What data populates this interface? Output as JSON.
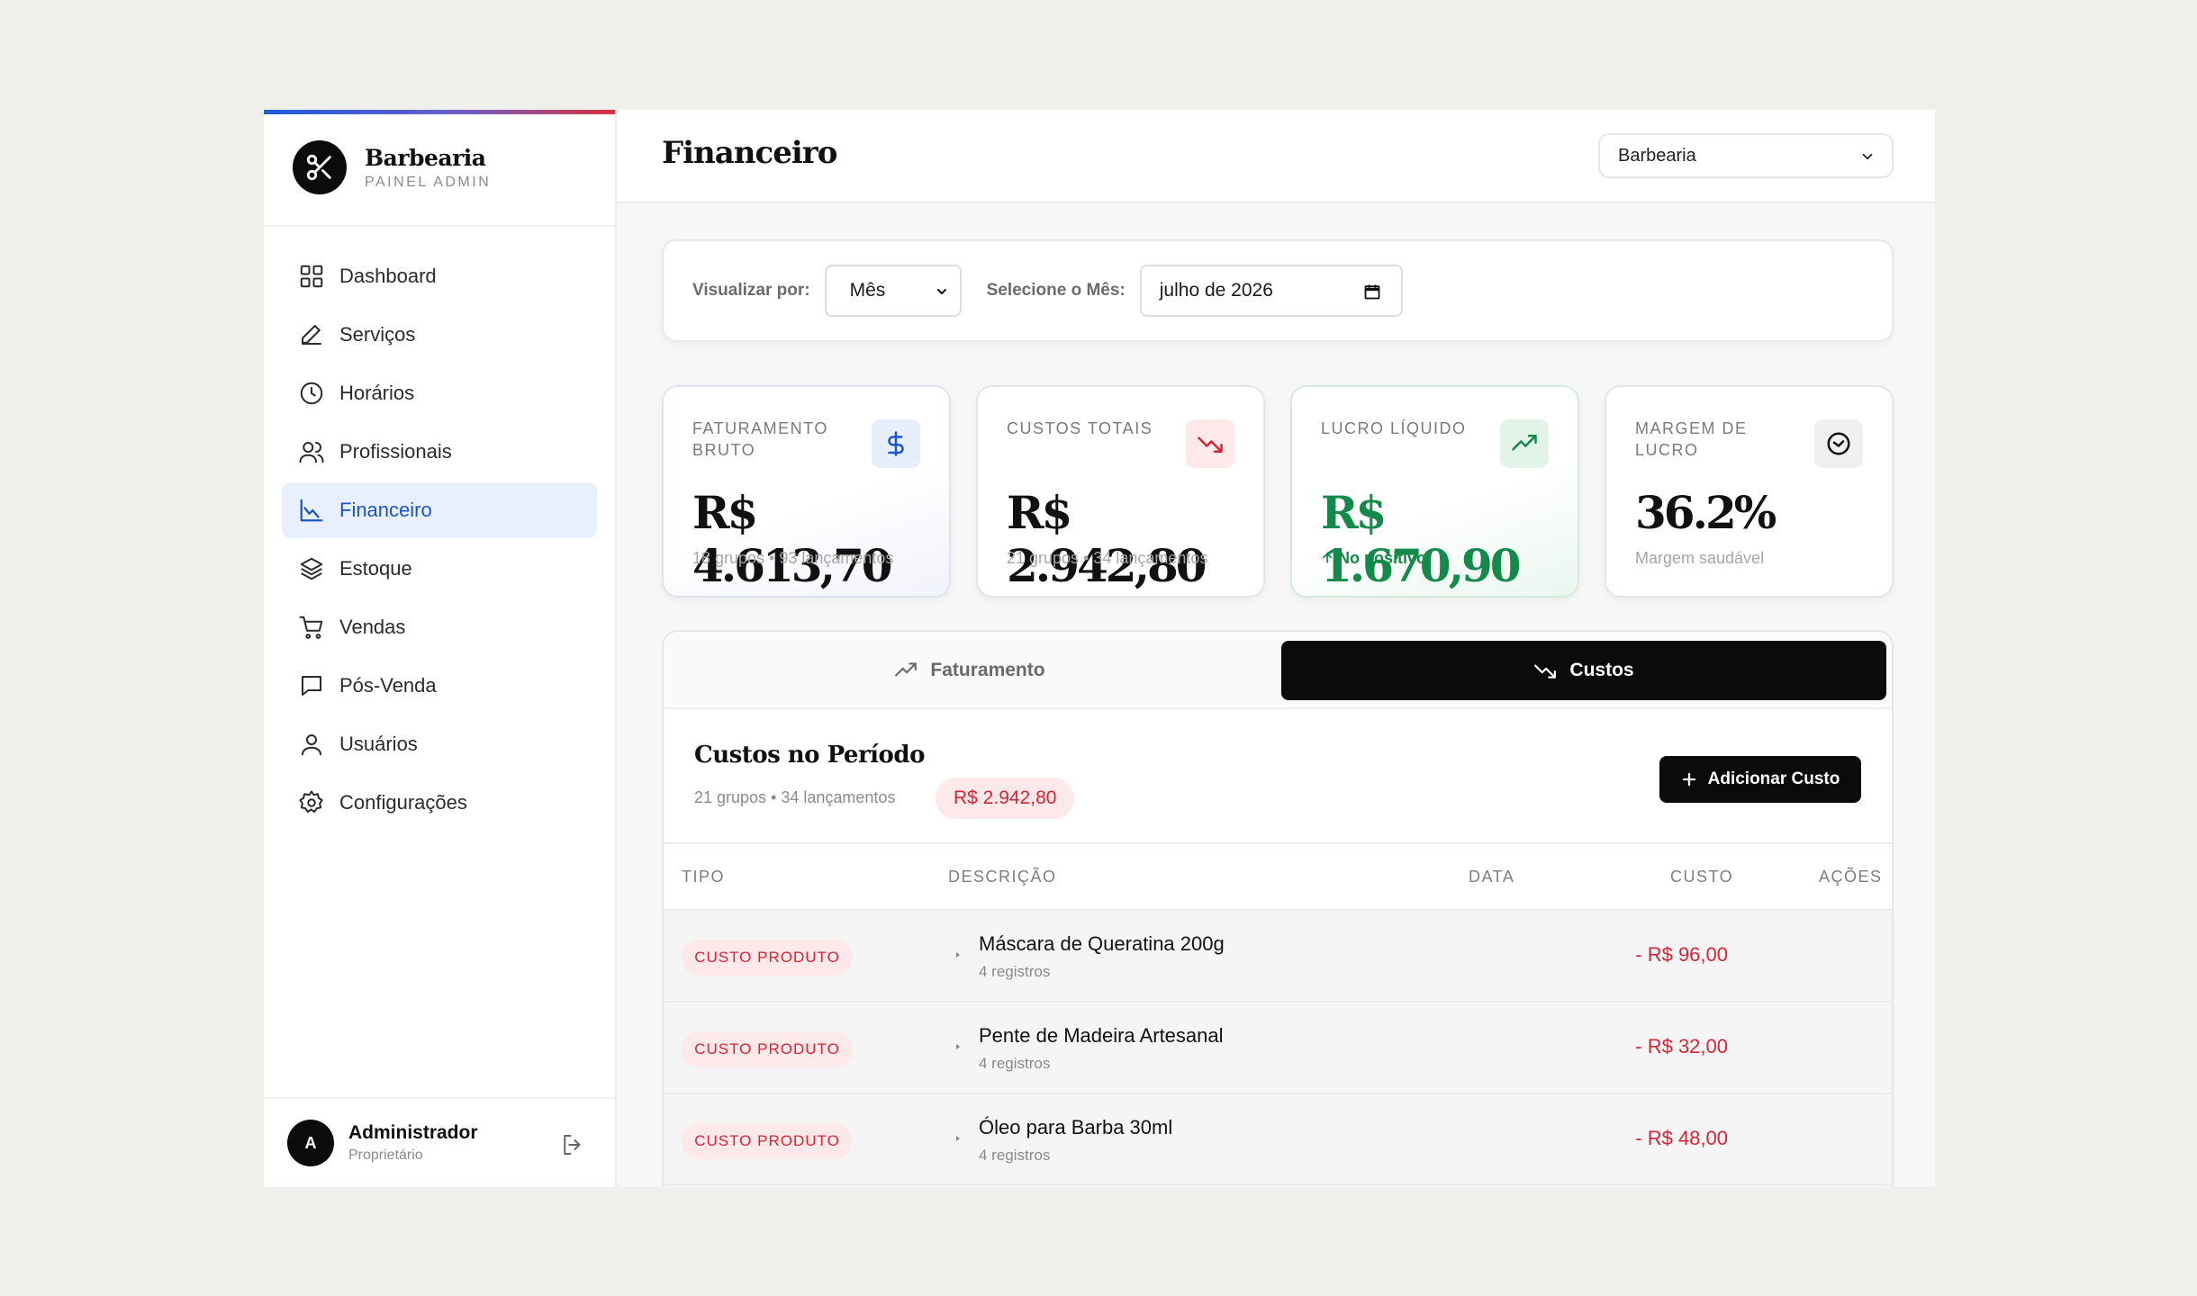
{
  "brand": {
    "name": "Barbearia",
    "subtitle": "PAINEL ADMIN"
  },
  "sidebar": {
    "items": [
      {
        "label": "Dashboard",
        "icon": "grid-icon"
      },
      {
        "label": "Serviços",
        "icon": "pencil-icon"
      },
      {
        "label": "Horários",
        "icon": "clock-icon"
      },
      {
        "label": "Profissionais",
        "icon": "users-icon"
      },
      {
        "label": "Financeiro",
        "icon": "chart-icon",
        "active": true
      },
      {
        "label": "Estoque",
        "icon": "layers-icon"
      },
      {
        "label": "Vendas",
        "icon": "cart-icon"
      },
      {
        "label": "Pós-Venda",
        "icon": "chat-icon"
      },
      {
        "label": "Usuários",
        "icon": "user-icon"
      },
      {
        "label": "Configurações",
        "icon": "gear-icon"
      }
    ]
  },
  "user": {
    "initial": "A",
    "name": "Administrador",
    "role": "Proprietário"
  },
  "header": {
    "title": "Financeiro",
    "store_select": "Barbearia"
  },
  "filters": {
    "view_label": "Visualizar por:",
    "view_value": "Mês",
    "month_label": "Selecione o Mês:",
    "month_value": "julho de 2026"
  },
  "kpis": [
    {
      "label": "FATURAMENTO BRUTO",
      "value": "R$ 4.613,70",
      "sub": "18 grupos • 93 lançamentos",
      "icon": "dollar-icon"
    },
    {
      "label": "CUSTOS TOTAIS",
      "value": "R$ 2.942,80",
      "sub": "21 grupos • 34 lançamentos",
      "icon": "trend-down-icon"
    },
    {
      "label": "LUCRO LÍQUIDO",
      "value": "R$ 1.670,90",
      "sub": "No positivo",
      "icon": "trend-up-icon"
    },
    {
      "label": "MARGEM DE LUCRO",
      "value": "36.2%",
      "sub": "Margem saudável",
      "icon": "gauge-icon"
    }
  ],
  "tabs": {
    "revenue": "Faturamento",
    "costs": "Custos"
  },
  "costs": {
    "title": "Custos no Período",
    "meta": "21 grupos • 34 lançamentos",
    "total": "R$ 2.942,80",
    "add_button": "Adicionar Custo",
    "columns": {
      "type": "TIPO",
      "description": "DESCRIÇÃO",
      "date": "DATA",
      "cost": "CUSTO",
      "actions": "AÇÕES"
    },
    "rows": [
      {
        "type": "CUSTO PRODUTO",
        "title": "Máscara de Queratina 200g",
        "sub": "4 registros",
        "cost": "- R$ 96,00"
      },
      {
        "type": "CUSTO PRODUTO",
        "title": "Pente de Madeira Artesanal",
        "sub": "4 registros",
        "cost": "- R$ 32,00"
      },
      {
        "type": "CUSTO PRODUTO",
        "title": "Óleo para Barba 30ml",
        "sub": "4 registros",
        "cost": "- R$ 48,00"
      }
    ]
  },
  "colors": {
    "accent": "#1d55c9",
    "danger": "#d92335",
    "success": "#13894a",
    "dark": "#0b0b0b"
  }
}
